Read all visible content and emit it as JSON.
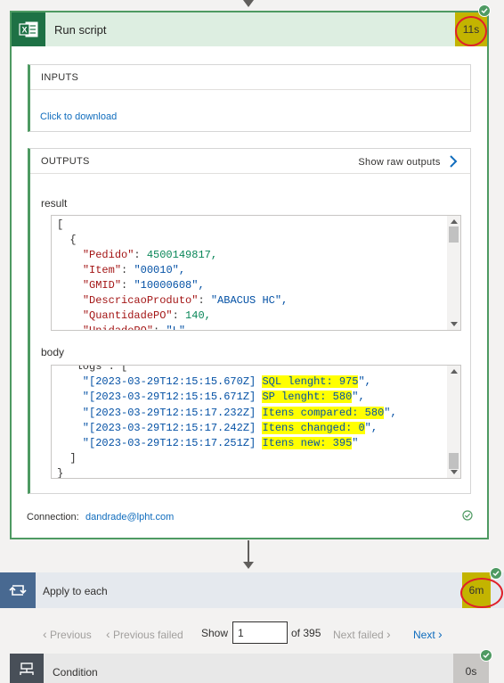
{
  "run_script": {
    "title": "Run script",
    "duration": "11s",
    "inputs": {
      "heading": "INPUTS",
      "download_link": "Click to download"
    },
    "outputs": {
      "heading": "OUTPUTS",
      "show_raw": "Show raw outputs",
      "result_label": "result",
      "result_lines": [
        [
          "[",
          "",
          "",
          ""
        ],
        [
          "  {",
          "",
          "",
          ""
        ],
        [
          "    ",
          "\"Pedido\"",
          ": ",
          "4500149817,"
        ],
        [
          "    ",
          "\"Item\"",
          ": ",
          "\"00010\","
        ],
        [
          "    ",
          "\"GMID\"",
          ": ",
          "\"10000608\","
        ],
        [
          "    ",
          "\"DescricaoProduto\"",
          ": ",
          "\"ABACUS HC\","
        ],
        [
          "    ",
          "\"QuantidadePO\"",
          ": ",
          "140,"
        ],
        [
          "    ",
          "\"UnidadePO\"",
          ": ",
          "\"L\","
        ]
      ],
      "body_label": "body",
      "body_lines": [
        {
          "ts": "  \"logs\": [",
          "msg": "",
          "tail": ""
        },
        {
          "ts": "    \"[2023-03-29T12:15:15.670Z]",
          "msg": "SQL lenght: 975",
          "tail": "\","
        },
        {
          "ts": "    \"[2023-03-29T12:15:15.671Z]",
          "msg": "SP lenght: 580",
          "tail": "\","
        },
        {
          "ts": "    \"[2023-03-29T12:15:17.232Z]",
          "msg": "Itens compared: 580",
          "tail": "\","
        },
        {
          "ts": "    \"[2023-03-29T12:15:17.242Z]",
          "msg": "Itens changed: 0",
          "tail": "\","
        },
        {
          "ts": "    \"[2023-03-29T12:15:17.251Z]",
          "msg": "Itens new: 395",
          "tail": "\""
        },
        {
          "ts": "  ]",
          "msg": "",
          "tail": ""
        },
        {
          "ts": "}",
          "msg": "",
          "tail": ""
        }
      ]
    },
    "connection_label": "Connection:",
    "connection_value": "dandrade@lpht.com"
  },
  "apply_to_each": {
    "title": "Apply to each",
    "duration": "6m",
    "pager": {
      "previous": "Previous",
      "previous_failed": "Previous failed",
      "show_label": "Show",
      "page_value": "1",
      "of_total": "of 395",
      "next_failed": "Next failed",
      "next": "Next"
    }
  },
  "condition": {
    "title": "Condition",
    "duration": "0s"
  },
  "colors": {
    "success": "#4e9a62",
    "excel": "#1e7145",
    "loop": "#486991",
    "link": "#0f6cbd",
    "highlight": "#ffff00",
    "annotation": "#e0202a"
  }
}
